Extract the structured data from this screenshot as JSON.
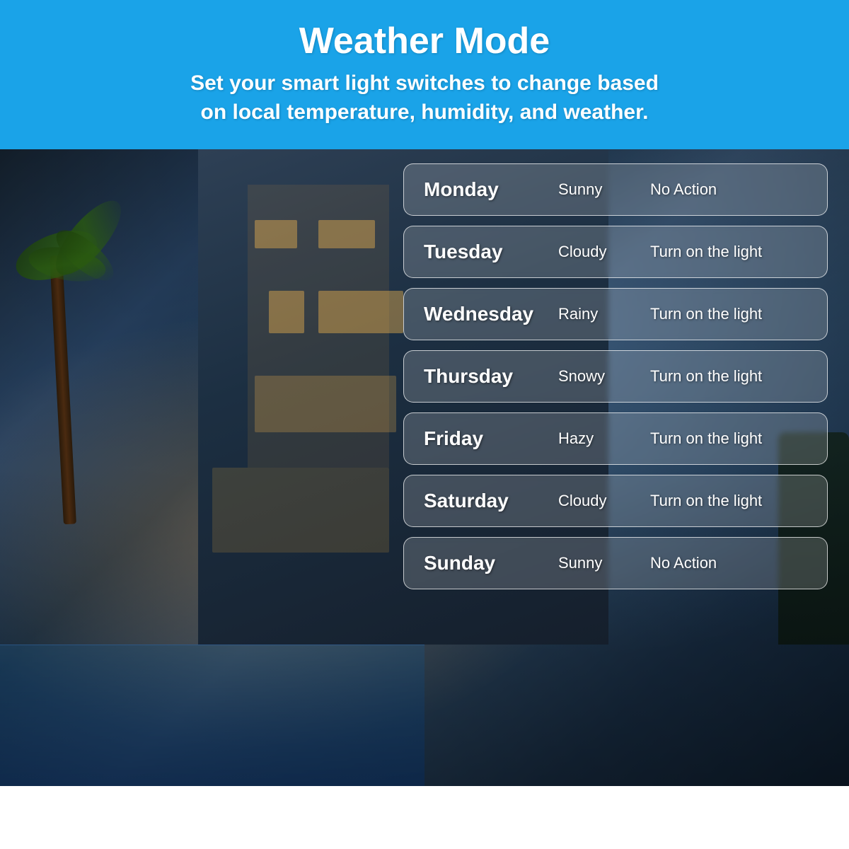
{
  "header": {
    "title": "Weather Mode",
    "subtitle_line1": "Set your smart light switches to change based",
    "subtitle_line2": "on local temperature, humidity, and weather."
  },
  "days": [
    {
      "id": "monday",
      "name": "Monday",
      "weather": "Sunny",
      "action": "No Action"
    },
    {
      "id": "tuesday",
      "name": "Tuesday",
      "weather": "Cloudy",
      "action": "Turn on the light"
    },
    {
      "id": "wednesday",
      "name": "Wednesday",
      "weather": "Rainy",
      "action": "Turn on the light"
    },
    {
      "id": "thursday",
      "name": "Thursday",
      "weather": "Snowy",
      "action": "Turn on the light"
    },
    {
      "id": "friday",
      "name": "Friday",
      "weather": "Hazy",
      "action": "Turn on the light"
    },
    {
      "id": "saturday",
      "name": "Saturday",
      "weather": "Cloudy",
      "action": "Turn on the light"
    },
    {
      "id": "sunday",
      "name": "Sunday",
      "weather": "Sunny",
      "action": "No Action"
    }
  ]
}
